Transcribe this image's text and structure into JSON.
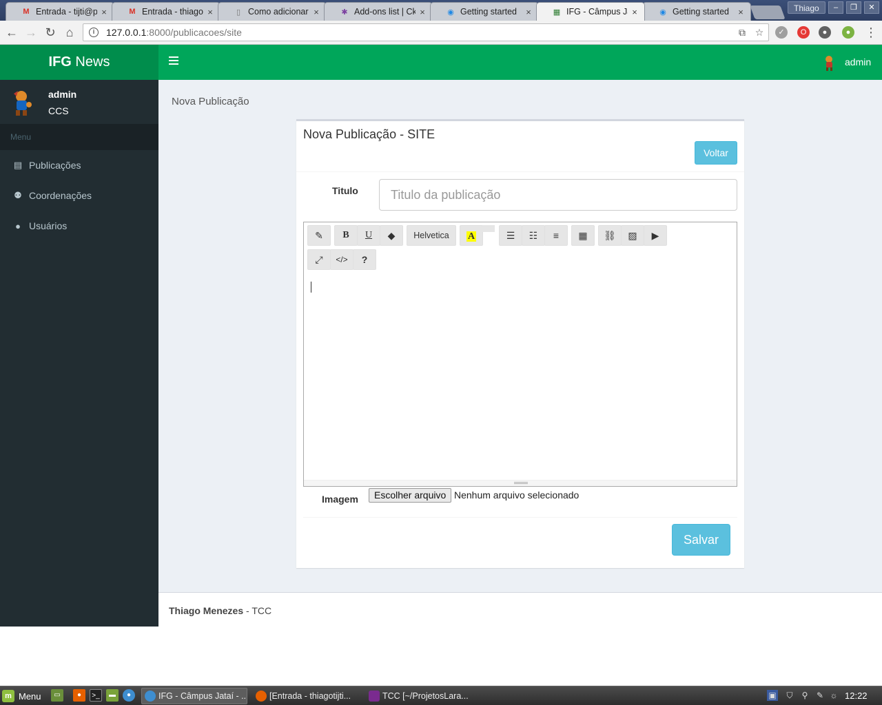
{
  "browser": {
    "tabs": [
      {
        "label": "Entrada - tijti@p",
        "icon": "gmail-icon",
        "color": "#d93025"
      },
      {
        "label": "Entrada - thiagoti",
        "icon": "gmail-icon",
        "color": "#d93025"
      },
      {
        "label": "Como adicionar",
        "icon": "page-icon",
        "color": "#777777"
      },
      {
        "label": "Add-ons list | Ck",
        "icon": "ckeditor-icon",
        "color": "#7b3fa0"
      },
      {
        "label": "Getting started",
        "icon": "summernote-icon",
        "color": "#1e88e5"
      },
      {
        "label": "IFG - Câmpus Jat",
        "icon": "ifg-icon",
        "color": "#2e7d32"
      },
      {
        "label": "Getting started",
        "icon": "summernote-icon",
        "color": "#1e88e5"
      }
    ],
    "active_tab": 5,
    "profile_name": "Thiago",
    "address": {
      "host": "127.0.0.1",
      "path": ":8000/publicacoes/site"
    }
  },
  "app": {
    "brand_bold": "IFG",
    "brand_rest": " News",
    "user": {
      "name": "admin",
      "role": "CCS"
    },
    "menu_header": "Menu",
    "menu": [
      {
        "label": "Publicações",
        "icon": "newspaper-icon"
      },
      {
        "label": "Coordenações",
        "icon": "users-icon"
      },
      {
        "label": "Usuários",
        "icon": "user-icon"
      }
    ],
    "header_user": "admin"
  },
  "page": {
    "breadcrumb": "Nova Publicação",
    "title": "Nova Publicação - SITE",
    "back_button": "Voltar",
    "titulo_label": "Titulo",
    "titulo_placeholder": "Titulo da publicação",
    "editor": {
      "font_name": "Helvetica",
      "toolbar_row1": [
        "magic-icon",
        "bold-icon",
        "underline-icon",
        "eraser-icon",
        "font-name",
        "color-icon",
        "ul-icon",
        "ol-icon",
        "align-icon",
        "table-icon",
        "link-icon",
        "picture-icon",
        "video-icon"
      ],
      "toolbar_row2": [
        "fullscreen-icon",
        "codeview-icon",
        "help-icon"
      ]
    },
    "imagem_label": "Imagem",
    "file_button": "Escolher arquivo",
    "file_status": "Nenhum arquivo selecionado",
    "save_button": "Salvar"
  },
  "footer": {
    "author": "Thiago Menezes",
    "rest": " - TCC"
  },
  "taskbar": {
    "start_label": "Menu",
    "tasks": [
      {
        "label": "IFG - Câmpus Jataí - ...",
        "icon": "chrome-icon",
        "color": "#3e8ed0"
      },
      {
        "label": "[Entrada - thiagotijti...",
        "icon": "firefox-icon",
        "color": "#e66000"
      },
      {
        "label": "TCC [~/ProjetosLara...",
        "icon": "phpstorm-icon",
        "color": "#7a2b8f"
      }
    ],
    "clock": "12:22"
  }
}
